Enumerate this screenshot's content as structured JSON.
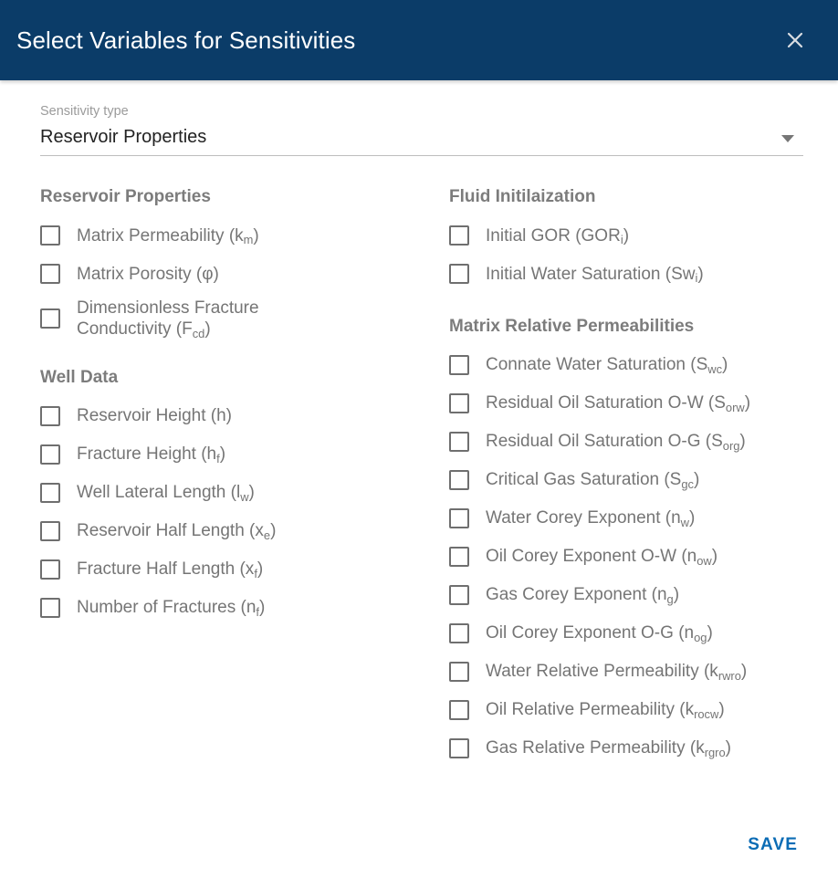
{
  "header": {
    "title": "Select Variables for Sensitivities",
    "close_icon": "close-icon",
    "background_color": "#0b3c68",
    "title_color": "#ffffff"
  },
  "sensitivity_type": {
    "label": "Sensitivity type",
    "value": "Reservoir Properties",
    "arrow_icon": "chevron-down-icon"
  },
  "left_column": [
    {
      "title": "Reservoir Properties",
      "items": [
        {
          "text": "Matrix Permeability (k",
          "sub": "m",
          "tail": ")",
          "checked": false
        },
        {
          "text": "Matrix Porosity (φ)",
          "sub": "",
          "tail": "",
          "checked": false
        },
        {
          "text": "Dimensionless Fracture\nConductivity (F",
          "sub": "cd",
          "tail": ")",
          "checked": false,
          "two_line": true
        }
      ]
    },
    {
      "title": "Well Data",
      "items": [
        {
          "text": "Reservoir Height (h)",
          "sub": "",
          "tail": "",
          "checked": false
        },
        {
          "text": "Fracture Height (h",
          "sub": "f",
          "tail": ")",
          "checked": false
        },
        {
          "text": "Well Lateral Length (l",
          "sub": "w",
          "tail": ")",
          "checked": false
        },
        {
          "text": "Reservoir Half Length (x",
          "sub": "e",
          "tail": ")",
          "checked": false
        },
        {
          "text": "Fracture Half Length (x",
          "sub": "f",
          "tail": ")",
          "checked": false
        },
        {
          "text": "Number of Fractures (n",
          "sub": "f",
          "tail": ")",
          "checked": false
        }
      ]
    }
  ],
  "right_column": [
    {
      "title": "Fluid Initilaization",
      "items": [
        {
          "text": "Initial GOR (GOR",
          "sub": "i",
          "tail": ")",
          "checked": false
        },
        {
          "text": "Initial Water Saturation (Sw",
          "sub": "i",
          "tail": ")",
          "checked": false
        }
      ]
    },
    {
      "title": "Matrix Relative Permeabilities",
      "items": [
        {
          "text": "Connate Water Saturation (S",
          "sub": "wc",
          "tail": ")",
          "checked": false
        },
        {
          "text": "Residual Oil Saturation O-W (S",
          "sub": "orw",
          "tail": ")",
          "checked": false
        },
        {
          "text": "Residual Oil Saturation O-G (S",
          "sub": "org",
          "tail": ")",
          "checked": false
        },
        {
          "text": "Critical Gas Saturation (S",
          "sub": "gc",
          "tail": ")",
          "checked": false
        },
        {
          "text": "Water Corey Exponent (n",
          "sub": "w",
          "tail": ")",
          "checked": false
        },
        {
          "text": "Oil Corey Exponent O-W (n",
          "sub": "ow",
          "tail": ")",
          "checked": false
        },
        {
          "text": "Gas Corey Exponent (n",
          "sub": "g",
          "tail": ")",
          "checked": false
        },
        {
          "text": "Oil Corey Exponent O-G (n",
          "sub": "og",
          "tail": ")",
          "checked": false
        },
        {
          "text": "Water Relative Permeability (k",
          "sub": "rwro",
          "tail": ")",
          "checked": false
        },
        {
          "text": "Oil Relative Permeability (k",
          "sub": "rocw",
          "tail": ")",
          "checked": false
        },
        {
          "text": "Gas Relative Permeability (k",
          "sub": "rgro",
          "tail": ")",
          "checked": false
        }
      ]
    }
  ],
  "footer": {
    "save_label": "SAVE",
    "save_color": "#0b6cb5"
  }
}
